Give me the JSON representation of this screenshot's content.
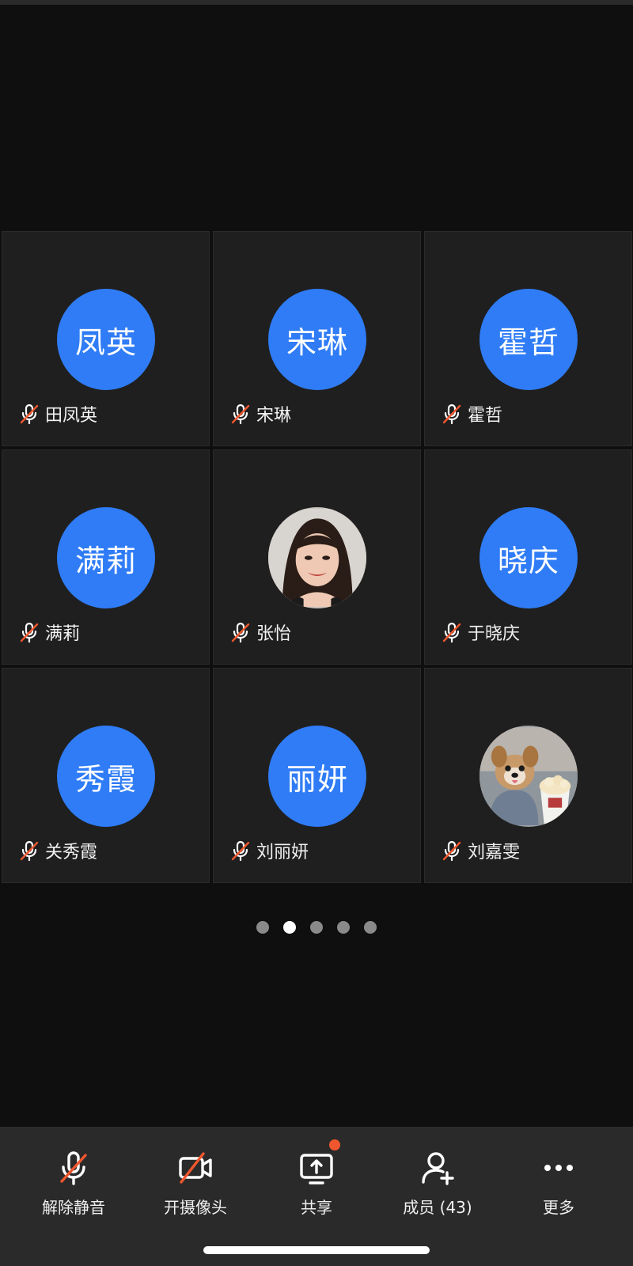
{
  "participants": [
    {
      "initials": "凤英",
      "name": "田凤英",
      "photo": null
    },
    {
      "initials": "宋琳",
      "name": "宋琳",
      "photo": null
    },
    {
      "initials": "霍哲",
      "name": "霍哲",
      "photo": null
    },
    {
      "initials": "满莉",
      "name": "满莉",
      "photo": null
    },
    {
      "initials": "",
      "name": "张怡",
      "photo": "woman-portrait"
    },
    {
      "initials": "晓庆",
      "name": "于晓庆",
      "photo": null
    },
    {
      "initials": "秀霞",
      "name": "关秀霞",
      "photo": null
    },
    {
      "initials": "丽妍",
      "name": "刘丽妍",
      "photo": null
    },
    {
      "initials": "",
      "name": "刘嘉雯",
      "photo": "dog-with-cup"
    }
  ],
  "pagination": {
    "total_pages": 5,
    "current_page": 2
  },
  "toolbar": {
    "unmute_label": "解除静音",
    "camera_label": "开摄像头",
    "share_label": "共享",
    "members_label": "成员 (43)",
    "more_label": "更多"
  },
  "colors": {
    "avatar_bg": "#2f7cf6",
    "muted_slash": "#f1572e",
    "badge": "#f1572e",
    "tile_bg": "#1f1f1f",
    "toolbar_bg": "#2a2a2a"
  },
  "icons": {
    "muted": "mic-muted-icon",
    "camera_off": "camera-off-icon",
    "share": "share-screen-icon",
    "members": "add-member-icon",
    "more": "more-icon"
  }
}
